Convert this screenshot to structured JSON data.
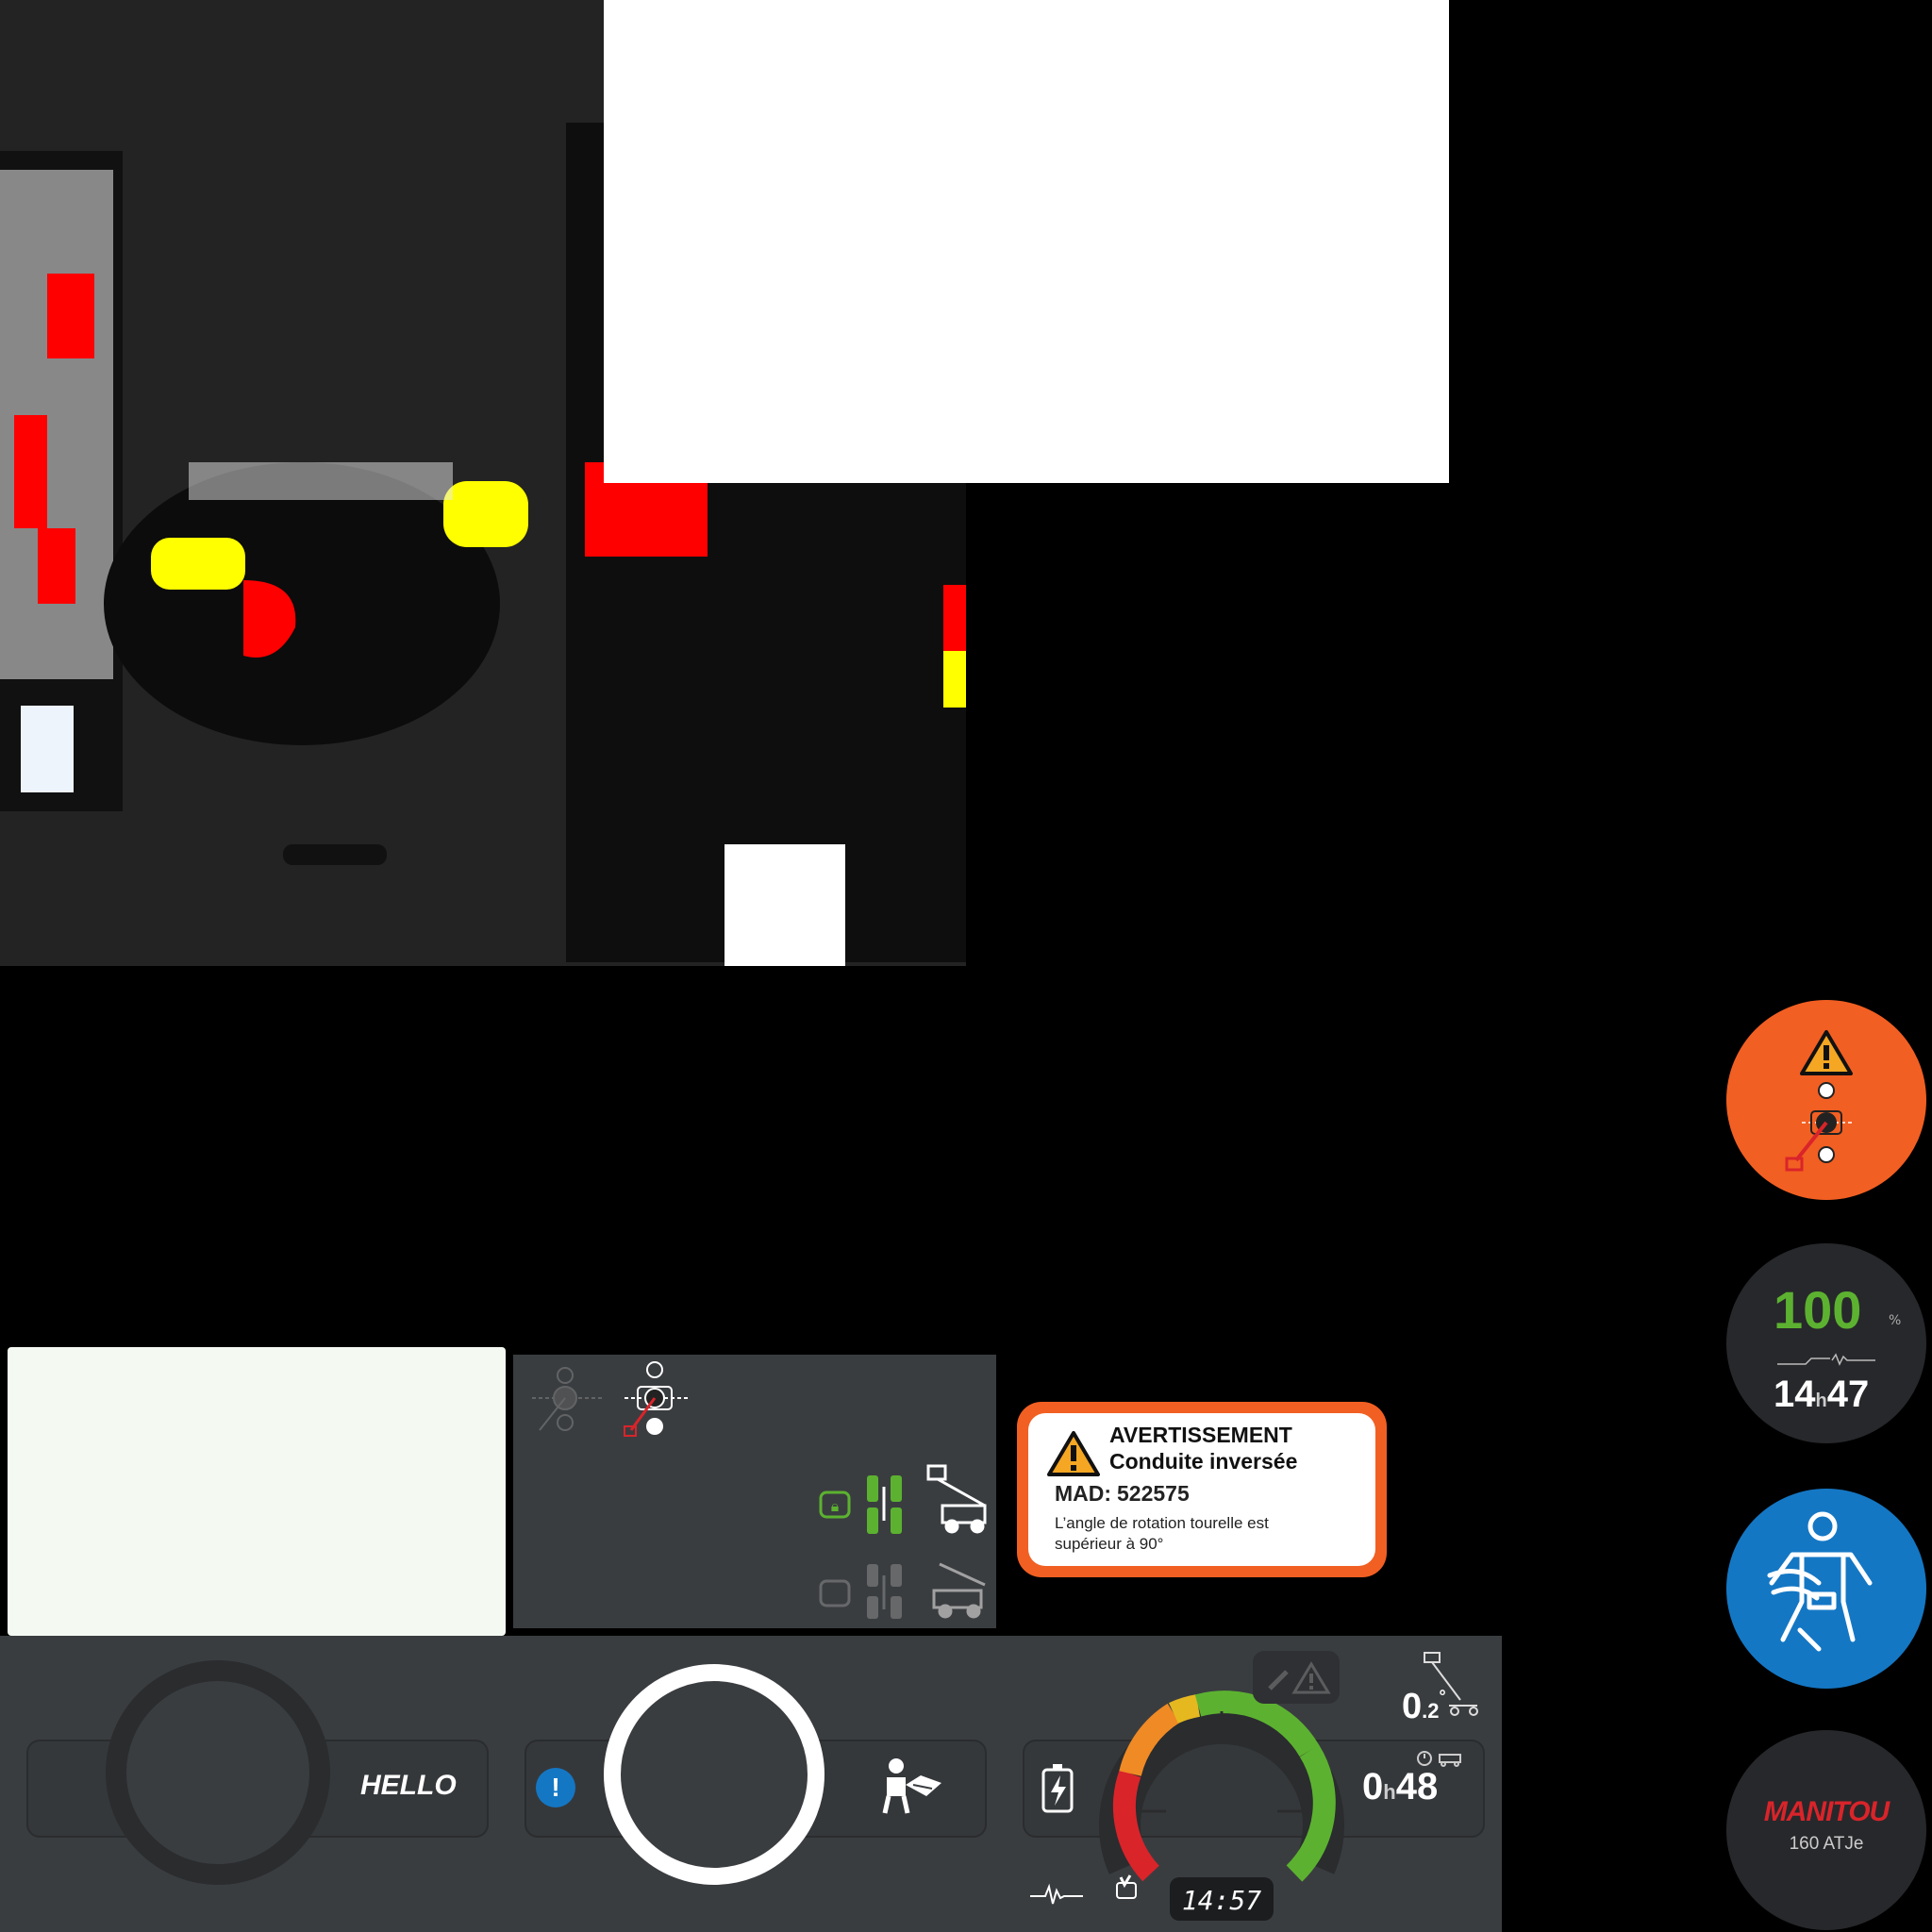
{
  "warning": {
    "title": "AVERTISSEMENT",
    "subtitle": "Conduite inversée",
    "mad_label": "MAD:",
    "mad_value": "522575",
    "message_line1": "L’angle de rotation tourelle est",
    "message_line2": "supérieur à 90°"
  },
  "battery": {
    "percent": "100",
    "percent_unit": "%",
    "hours": "14",
    "hours_sep": "h",
    "minutes": "47"
  },
  "brand": {
    "logo_text": "MANITOU",
    "model": "160 ATJe"
  },
  "dashboard": {
    "hello_label": "HELLO",
    "angle_value": "0",
    "angle_decimal": ".2",
    "angle_unit": "°",
    "timer_hours": "0",
    "timer_sep": "h",
    "timer_minutes": "48",
    "clock": "14:57"
  },
  "colors": {
    "orange": "#f25f22",
    "blue": "#1477c4",
    "green": "#5cb230",
    "red": "#d9242a",
    "panel": "#3a3d40",
    "brand_red": "#d9242a"
  },
  "icons": {
    "warning": "warning-triangle-icon",
    "tilt": "turret-rotation-icon",
    "harness": "safety-harness-icon",
    "battery": "battery-charging-icon",
    "operator": "operator-manual-icon",
    "info": "info-exclamation-icon"
  },
  "gauge": {
    "level_fraction": 0.85
  }
}
